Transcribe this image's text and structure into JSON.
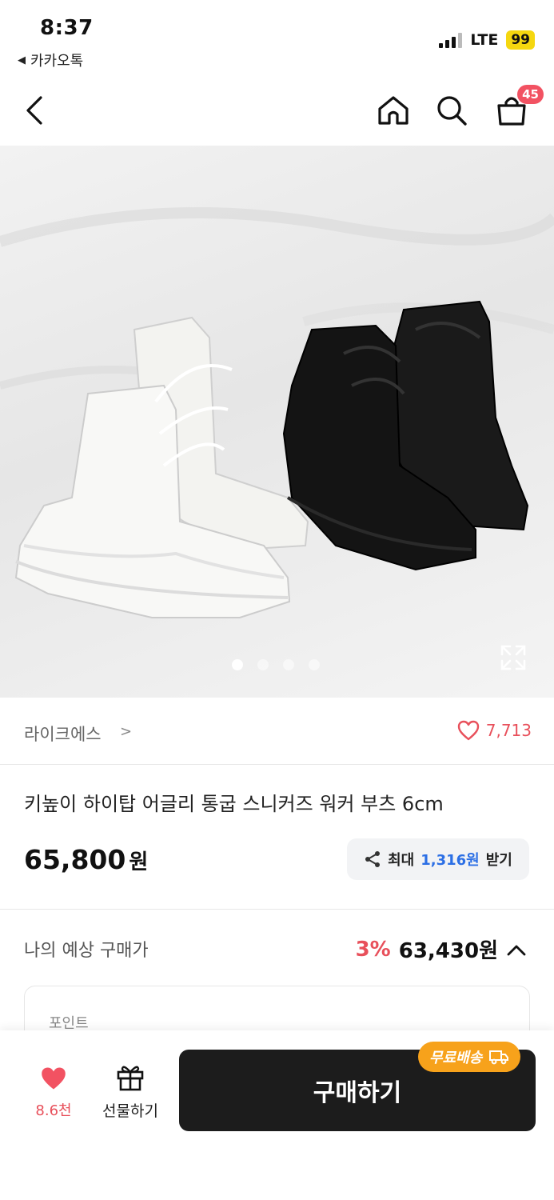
{
  "status": {
    "time": "8:37",
    "back_app": "카카오톡",
    "network": "LTE",
    "battery": "99"
  },
  "nav": {
    "cart_count": "45"
  },
  "gallery": {
    "active_index": 0,
    "count": 4
  },
  "brand": {
    "name": "라이크에스",
    "likes": "7,713"
  },
  "product": {
    "title": "키높이 하이탑 어글리 통굽 스니커즈 워커 부츠 6cm",
    "price": "65,800",
    "price_unit": "원",
    "reward_prefix": "최대",
    "reward_amount": "1,316원",
    "reward_suffix": "받기"
  },
  "expected": {
    "label": "나의 예상 구매가",
    "discount": "3%",
    "price": "63,430원"
  },
  "points": {
    "label": "포인트"
  },
  "bottom": {
    "wish_count": "8.6천",
    "gift_label": "선물하기",
    "buy_label": "구매하기",
    "shipping_badge": "무료배송"
  },
  "colors": {
    "accent_red": "#e8505b",
    "buy_button": "#1c1c1c",
    "badge_orange": "#f7a21b",
    "link_blue": "#2c6fe5"
  }
}
